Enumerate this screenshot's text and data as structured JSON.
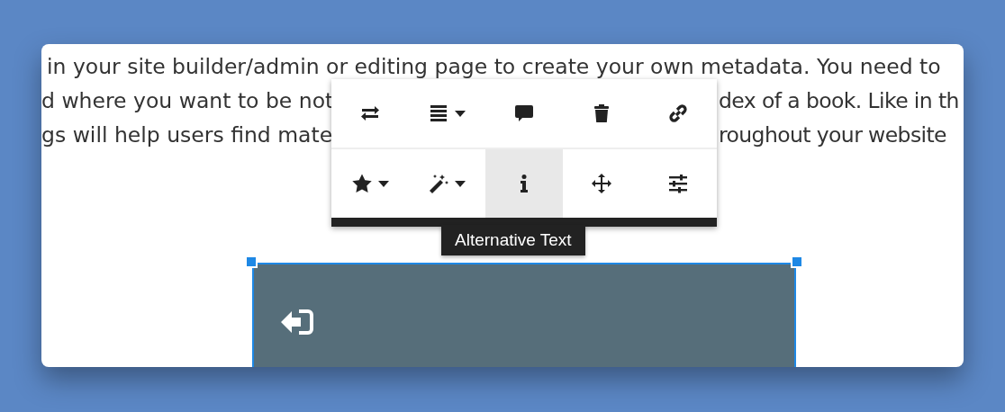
{
  "text_lines": [
    {
      "left": "in your site builder/admin or editing page to create your own metadata. You need to"
    },
    {
      "left": "d where you want to be not",
      "right": "dex of a book. Like in th"
    },
    {
      "left": "gs will help users find mate",
      "right": "roughout your website"
    }
  ],
  "toolbar": {
    "rows": [
      [
        {
          "dropdown": false,
          "selected": false
        },
        {
          "dropdown": true,
          "selected": false
        },
        {
          "dropdown": false,
          "selected": false
        },
        {
          "dropdown": false,
          "selected": false
        },
        {
          "dropdown": false,
          "selected": false
        }
      ],
      [
        {
          "dropdown": true,
          "selected": false
        },
        {
          "dropdown": true,
          "selected": false
        },
        {
          "dropdown": false,
          "selected": true
        },
        {
          "dropdown": false,
          "selected": false
        },
        {
          "dropdown": false,
          "selected": false
        }
      ]
    ]
  },
  "tooltip": "Alternative Text",
  "image_block": {
    "selected": true
  }
}
